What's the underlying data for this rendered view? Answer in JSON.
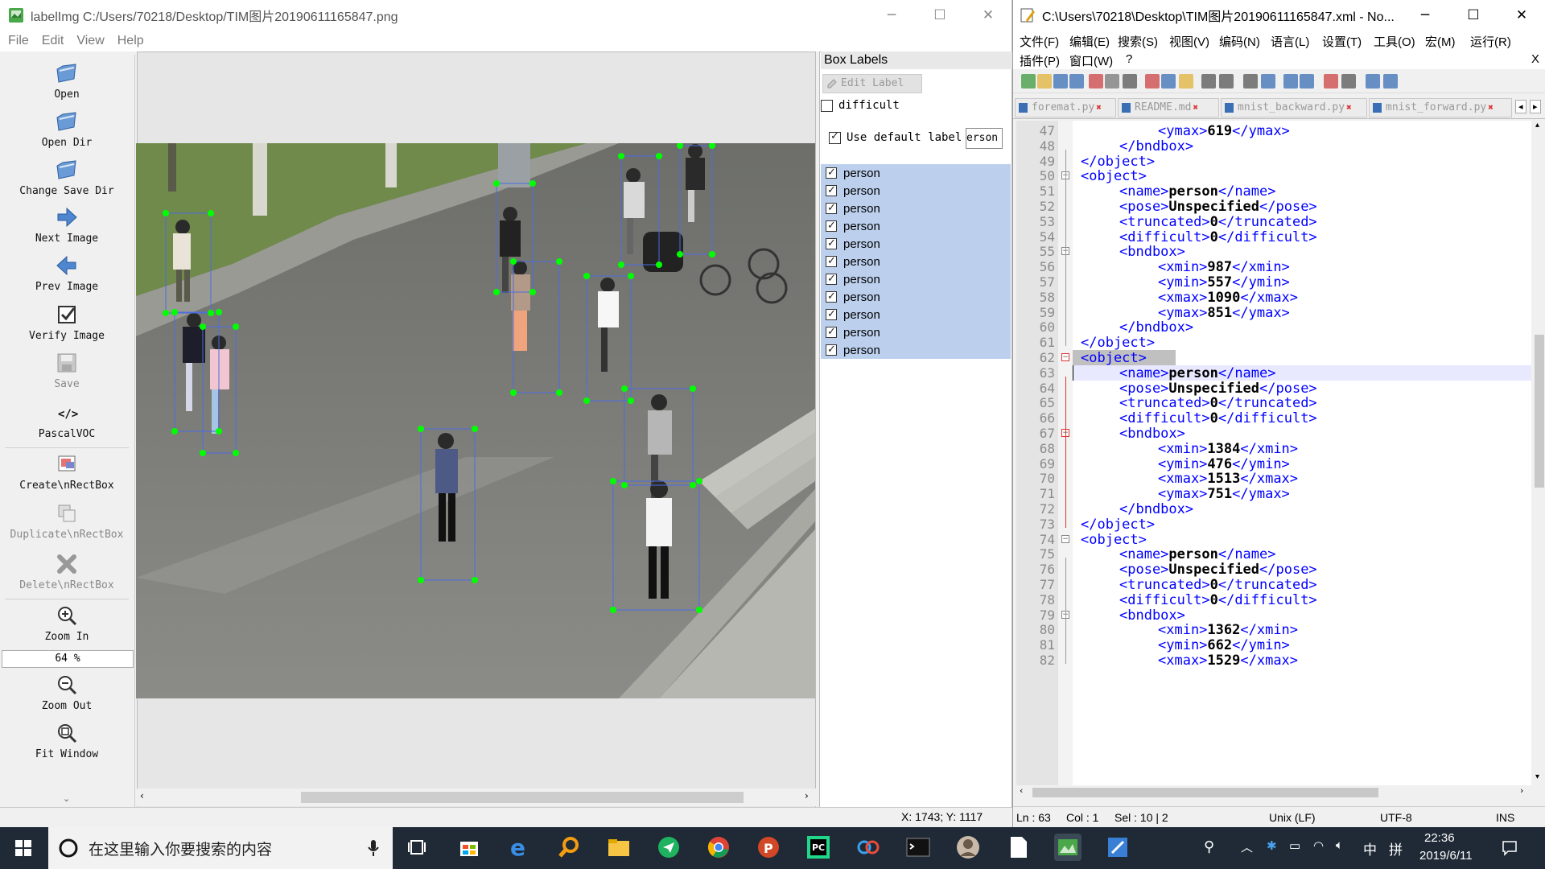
{
  "labelimg": {
    "title": "labelImg C:/Users/70218/Desktop/TIM图片20190611165847.png",
    "menu": [
      "File",
      "Edit",
      "View",
      "Help"
    ],
    "tools": [
      {
        "label": "Open",
        "icon": "folder-open-icon",
        "enabled": true
      },
      {
        "label": "Open Dir",
        "icon": "folder-open-icon",
        "enabled": true
      },
      {
        "label": "Change Save Dir",
        "icon": "folder-open-icon",
        "enabled": true
      },
      {
        "label": "Next Image",
        "icon": "arrow-right-icon",
        "enabled": true
      },
      {
        "label": "Prev Image",
        "icon": "arrow-left-icon",
        "enabled": true
      },
      {
        "label": "Verify Image",
        "icon": "check-box-icon",
        "enabled": true
      },
      {
        "label": "Save",
        "icon": "save-icon",
        "enabled": false
      },
      {
        "label": "PascalVOC",
        "icon": "code-icon",
        "enabled": true
      },
      {
        "label": "Create\\nRectBox",
        "icon": "create-rect-icon",
        "enabled": true
      },
      {
        "label": "Duplicate\\nRectBox",
        "icon": "duplicate-icon",
        "enabled": false
      },
      {
        "label": "Delete\\nRectBox",
        "icon": "delete-icon",
        "enabled": false
      },
      {
        "label": "Zoom In",
        "icon": "zoom-in-icon",
        "enabled": true
      },
      {
        "label": "Zoom Out",
        "icon": "zoom-out-icon",
        "enabled": true
      },
      {
        "label": "Fit Window",
        "icon": "fit-window-icon",
        "enabled": true
      }
    ],
    "zoom_value": "64 %",
    "box_labels_title": "Box Labels",
    "edit_label_button": "Edit Label",
    "difficult_label": "difficult",
    "difficult_checked": false,
    "use_default_label": "Use default label",
    "use_default_checked": true,
    "default_label_value": "erson",
    "labels": [
      "person",
      "person",
      "person",
      "person",
      "person",
      "person",
      "person",
      "person",
      "person",
      "person",
      "person"
    ],
    "status_coords": "X: 1743; Y: 1117"
  },
  "npp": {
    "title": "C:\\Users\\70218\\Desktop\\TIM图片20190611165847.xml - No...",
    "menu_row1": [
      "文件(F)",
      "编辑(E)",
      "搜索(S)",
      "视图(V)",
      "编码(N)",
      "语言(L)",
      "设置(T)",
      "工具(O)",
      "宏(M)",
      "运行(R)"
    ],
    "menu_row2": [
      "插件(P)",
      "窗口(W)",
      "?"
    ],
    "close_x": "X",
    "tabs": [
      "foremat.py",
      "README.md",
      "mnist_backward.py",
      "mnist_forward.py"
    ],
    "lines": [
      {
        "no": "47",
        "indent": 3,
        "pre": "<ymax>",
        "val": "619",
        "post": "</ymax>"
      },
      {
        "no": "48",
        "indent": 2,
        "pre": "</bndbox>",
        "val": "",
        "post": ""
      },
      {
        "no": "49",
        "indent": 1,
        "pre": "</object>",
        "val": "",
        "post": ""
      },
      {
        "no": "50",
        "indent": 1,
        "pre": "<object>",
        "val": "",
        "post": ""
      },
      {
        "no": "51",
        "indent": 2,
        "pre": "<name>",
        "val": "person",
        "post": "</name>"
      },
      {
        "no": "52",
        "indent": 2,
        "pre": "<pose>",
        "val": "Unspecified",
        "post": "</pose>"
      },
      {
        "no": "53",
        "indent": 2,
        "pre": "<truncated>",
        "val": "0",
        "post": "</truncated>"
      },
      {
        "no": "54",
        "indent": 2,
        "pre": "<difficult>",
        "val": "0",
        "post": "</difficult>"
      },
      {
        "no": "55",
        "indent": 2,
        "pre": "<bndbox>",
        "val": "",
        "post": ""
      },
      {
        "no": "56",
        "indent": 3,
        "pre": "<xmin>",
        "val": "987",
        "post": "</xmin>"
      },
      {
        "no": "57",
        "indent": 3,
        "pre": "<ymin>",
        "val": "557",
        "post": "</ymin>"
      },
      {
        "no": "58",
        "indent": 3,
        "pre": "<xmax>",
        "val": "1090",
        "post": "</xmax>"
      },
      {
        "no": "59",
        "indent": 3,
        "pre": "<ymax>",
        "val": "851",
        "post": "</ymax>"
      },
      {
        "no": "60",
        "indent": 2,
        "pre": "</bndbox>",
        "val": "",
        "post": ""
      },
      {
        "no": "61",
        "indent": 1,
        "pre": "</object>",
        "val": "",
        "post": ""
      },
      {
        "no": "62",
        "indent": 1,
        "pre": "<object>",
        "val": "",
        "post": ""
      },
      {
        "no": "63",
        "indent": 2,
        "pre": "<name>",
        "val": "person",
        "post": "</name>"
      },
      {
        "no": "64",
        "indent": 2,
        "pre": "<pose>",
        "val": "Unspecified",
        "post": "</pose>"
      },
      {
        "no": "65",
        "indent": 2,
        "pre": "<truncated>",
        "val": "0",
        "post": "</truncated>"
      },
      {
        "no": "66",
        "indent": 2,
        "pre": "<difficult>",
        "val": "0",
        "post": "</difficult>"
      },
      {
        "no": "67",
        "indent": 2,
        "pre": "<bndbox>",
        "val": "",
        "post": ""
      },
      {
        "no": "68",
        "indent": 3,
        "pre": "<xmin>",
        "val": "1384",
        "post": "</xmin>"
      },
      {
        "no": "69",
        "indent": 3,
        "pre": "<ymin>",
        "val": "476",
        "post": "</ymin>"
      },
      {
        "no": "70",
        "indent": 3,
        "pre": "<xmax>",
        "val": "1513",
        "post": "</xmax>"
      },
      {
        "no": "71",
        "indent": 3,
        "pre": "<ymax>",
        "val": "751",
        "post": "</ymax>"
      },
      {
        "no": "72",
        "indent": 2,
        "pre": "</bndbox>",
        "val": "",
        "post": ""
      },
      {
        "no": "73",
        "indent": 1,
        "pre": "</object>",
        "val": "",
        "post": ""
      },
      {
        "no": "74",
        "indent": 1,
        "pre": "<object>",
        "val": "",
        "post": ""
      },
      {
        "no": "75",
        "indent": 2,
        "pre": "<name>",
        "val": "person",
        "post": "</name>"
      },
      {
        "no": "76",
        "indent": 2,
        "pre": "<pose>",
        "val": "Unspecified",
        "post": "</pose>"
      },
      {
        "no": "77",
        "indent": 2,
        "pre": "<truncated>",
        "val": "0",
        "post": "</truncated>"
      },
      {
        "no": "78",
        "indent": 2,
        "pre": "<difficult>",
        "val": "0",
        "post": "</difficult>"
      },
      {
        "no": "79",
        "indent": 2,
        "pre": "<bndbox>",
        "val": "",
        "post": ""
      },
      {
        "no": "80",
        "indent": 3,
        "pre": "<xmin>",
        "val": "1362",
        "post": "</xmin>"
      },
      {
        "no": "81",
        "indent": 3,
        "pre": "<ymin>",
        "val": "662",
        "post": "</ymin>"
      },
      {
        "no": "82",
        "indent": 3,
        "pre": "<xmax>",
        "val": "1529",
        "post": "</xmax>"
      }
    ],
    "status": {
      "ln_col": "Ln : 63",
      "col": "Col : 1",
      "sel": "Sel : 10 | 2",
      "eol": "Unix (LF)",
      "encoding": "UTF-8",
      "mode": "INS"
    }
  },
  "taskbar": {
    "search_placeholder": "在这里输入你要搜索的内容",
    "time": "22:36",
    "date": "2019/6/11",
    "ime": "中",
    "ime2": "拼"
  },
  "colors": {
    "box_point": "#00ff00",
    "box_line": "#4c6ce0",
    "label_selected_bg": "#bcd0ee",
    "xml_tag": "#0000ff",
    "taskbar_bg": "#1f2a36"
  }
}
